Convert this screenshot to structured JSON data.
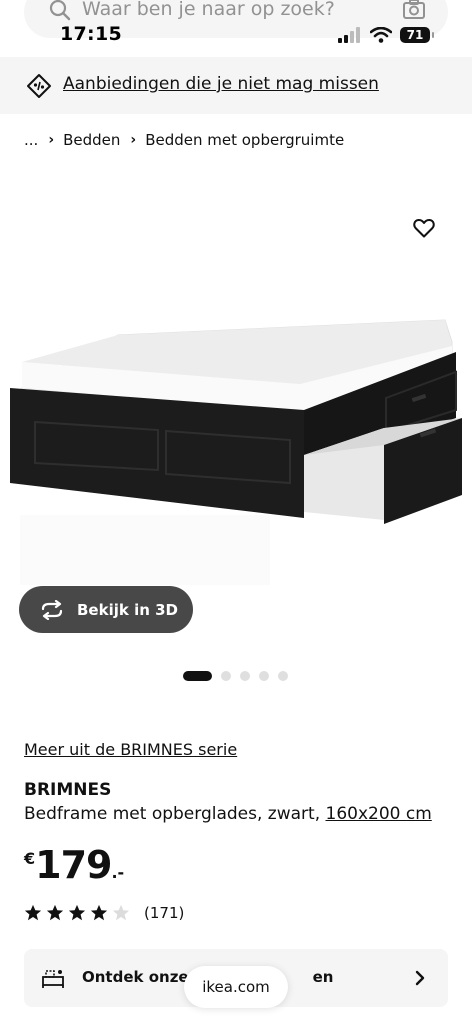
{
  "status_bar": {
    "time": "17:15",
    "battery": "71"
  },
  "search": {
    "placeholder": "Waar ben je naar op zoek?"
  },
  "promo": {
    "text": "Aanbiedingen die je niet mag missen"
  },
  "breadcrumb": {
    "ellipsis": "...",
    "items": [
      "Bedden",
      "Bedden met opbergruimte"
    ]
  },
  "gallery": {
    "view3d_label": "Bekijk in 3D",
    "slide_count": 5,
    "active_slide": 1
  },
  "product": {
    "series_link": "Meer uit de BRIMNES serie",
    "name": "BRIMNES",
    "description": "Bedframe met opberglades, zwart, ",
    "size": "160x200 cm",
    "price": {
      "currency": "€",
      "amount": "179",
      "decimals": ".-"
    },
    "rating": 4,
    "rating_max": 5,
    "review_count": "(171)"
  },
  "discover": {
    "text_start": "Ontdek onze b",
    "text_end": "en"
  },
  "browser": {
    "url": "ikea.com"
  },
  "icons": [
    "search-icon",
    "camera-icon",
    "tag-icon",
    "heart-icon",
    "rotate-3d-icon",
    "star-icon",
    "bed-icon",
    "chevron-right-icon",
    "signal-icon",
    "wifi-icon"
  ],
  "colors": {
    "dark_button": "#484848",
    "panel_bg": "#f5f5f5",
    "bed_frame": "#1c1c1c",
    "text": "#111111"
  }
}
